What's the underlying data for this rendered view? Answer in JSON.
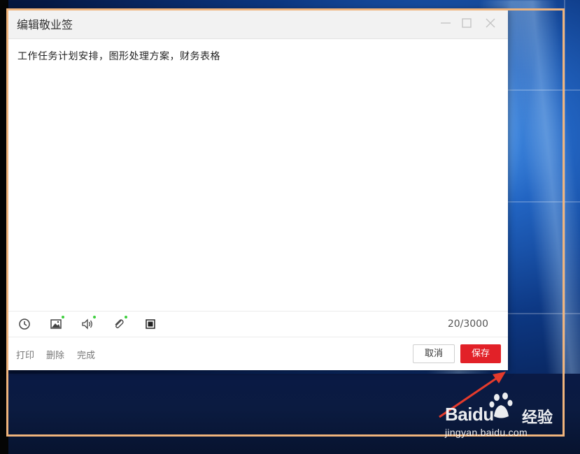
{
  "dialog": {
    "title": "编辑敬业签",
    "title_bar_icons": [
      "minimize-icon",
      "maximize-icon",
      "close-icon"
    ],
    "content_text": "工作任务计划安排，图形处理方案，财务表格",
    "toolbar": {
      "icons": [
        "clock-icon",
        "image-icon",
        "speaker-icon",
        "paperclip-icon",
        "stop-square-icon"
      ],
      "char_counter": "20/3000"
    },
    "footer": {
      "print_label": "打印",
      "delete_label": "删除",
      "done_label": "完成",
      "cancel_label": "取消",
      "save_label": "保存"
    }
  },
  "colors": {
    "save_button": "#e22128",
    "highlight_frame": "#f0b47c",
    "annotation_arrow": "#e53b2c",
    "status_dot": "#3fcf3f"
  },
  "watermark": {
    "brand_text": "Baidu",
    "cn_text": "经验",
    "url": "jingyan.baidu.com"
  }
}
